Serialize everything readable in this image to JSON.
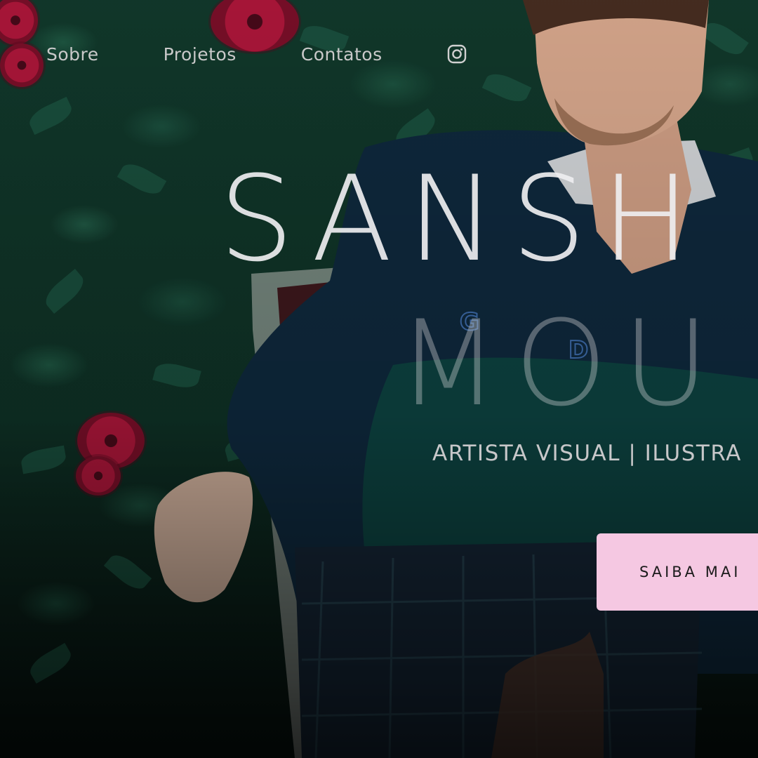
{
  "nav": {
    "items": [
      {
        "label": "Sobre"
      },
      {
        "label": "Projetos"
      },
      {
        "label": "Contatos"
      }
    ],
    "social_icon": "instagram-icon"
  },
  "hero": {
    "title_line_1": "SANSH",
    "title_line_2": "MOU",
    "subtitle": "ARTISTA VISUAL | ILUSTRA",
    "cta_label": "SAIBA MAI"
  },
  "colors": {
    "cta_background": "#f5c8e2",
    "nav_text": "#c9c9c9",
    "foliage": "#1e5a45",
    "flower": "#b3173c"
  }
}
